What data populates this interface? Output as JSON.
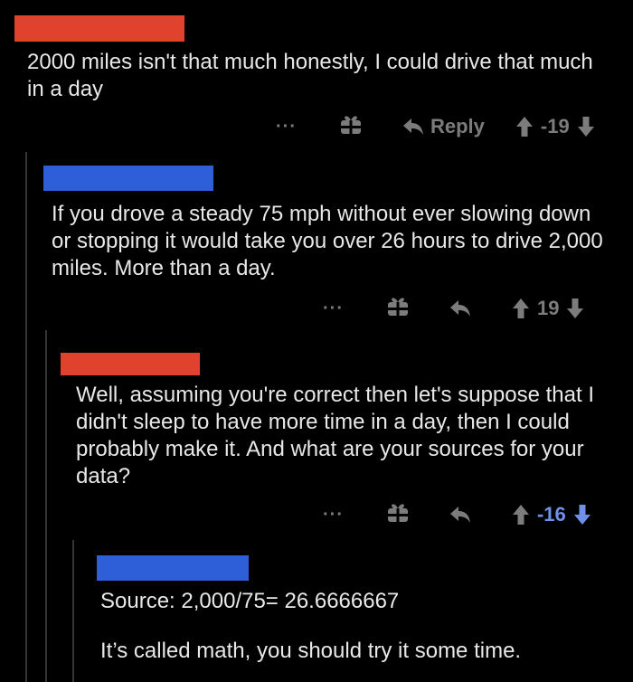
{
  "colors": {
    "background": "#000000",
    "text": "#e8e8e8",
    "muted": "#7c7c7c",
    "redact_red": "#e0422e",
    "redact_blue": "#2e5fd8",
    "thread_line": "#343536",
    "downvote_blue": "#6f8fe8"
  },
  "comments": [
    {
      "text": "2000 miles isn't that much honestly, I could drive that much in a day",
      "reply_label": "Reply",
      "score": "-19",
      "more": "···"
    },
    {
      "text": "If you drove a steady 75 mph without ever slowing down or stopping it would take you over 26 hours to drive 2,000 miles. More than a day.",
      "score": "19",
      "more": "···"
    },
    {
      "text": "Well, assuming you're correct then let's suppose that I didn't sleep to have more time in a day, then I could probably make it. And what are your sources for your data?",
      "score": "-16",
      "more": "···"
    },
    {
      "line1": "Source: 2,000/75= 26.6666667",
      "line2": "It’s called math, you should try it some time."
    }
  ]
}
